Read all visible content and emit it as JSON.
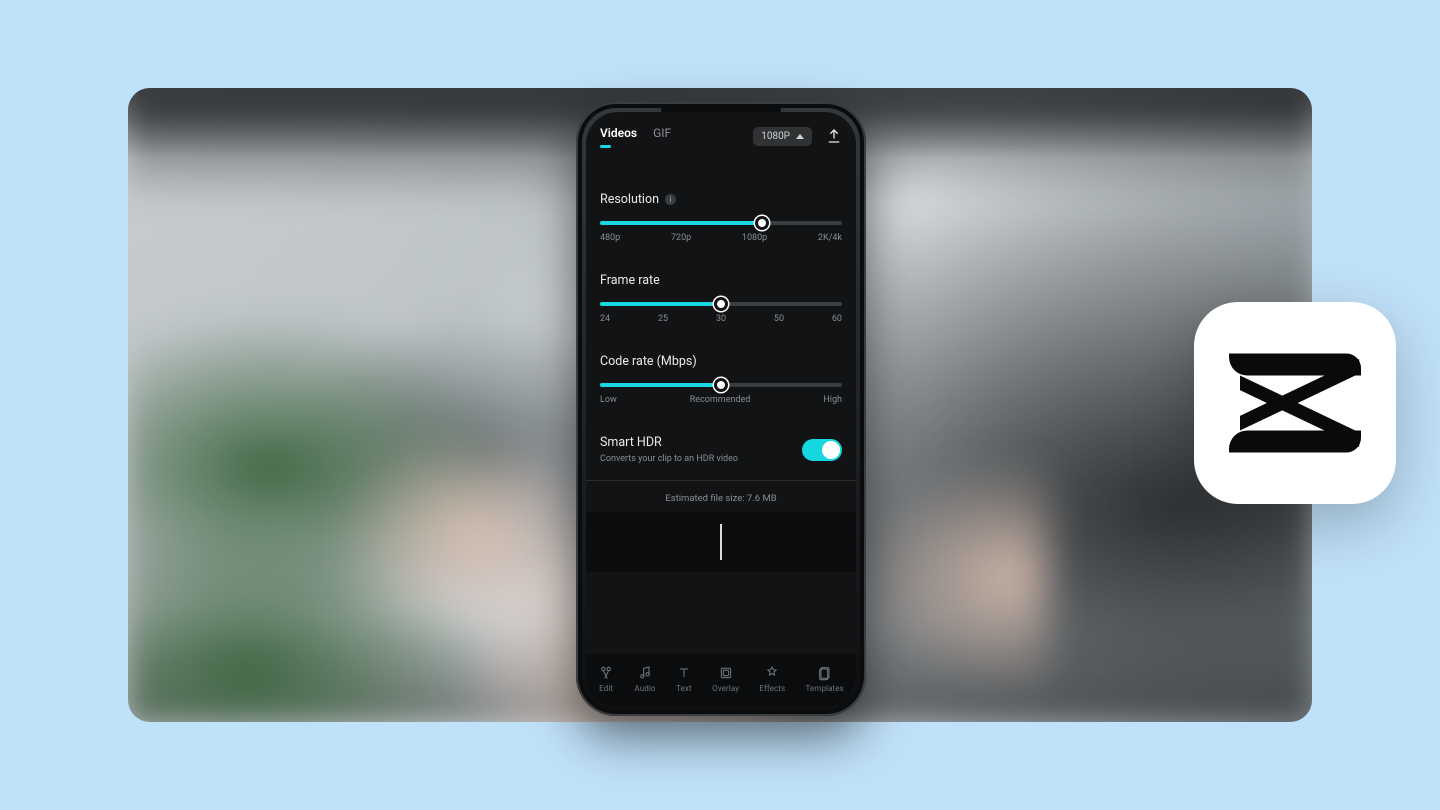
{
  "topbar": {
    "tabs": {
      "videos": "Videos",
      "gif": "GIF"
    },
    "resolution_button": "1080P"
  },
  "resolution": {
    "label": "Resolution",
    "ticks": [
      "480p",
      "720p",
      "1080p",
      "2K/4k"
    ],
    "fill_pct": 67,
    "thumb_pct": 67
  },
  "framerate": {
    "label": "Frame rate",
    "ticks": [
      "24",
      "25",
      "30",
      "50",
      "60"
    ],
    "fill_pct": 50,
    "thumb_pct": 50
  },
  "coderate": {
    "label": "Code rate (Mbps)",
    "ticks": [
      "Low",
      "Recommended",
      "High"
    ],
    "fill_pct": 50,
    "thumb_pct": 50
  },
  "smarthdr": {
    "label": "Smart HDR",
    "sub": "Converts your clip to an HDR video",
    "on": true
  },
  "estimate": "Estimated file size: 7.6 MB",
  "toolbar": {
    "items": [
      {
        "id": "edit",
        "label": "Edit"
      },
      {
        "id": "audio",
        "label": "Audio"
      },
      {
        "id": "text",
        "label": "Text"
      },
      {
        "id": "overlay",
        "label": "Overlay"
      },
      {
        "id": "effects",
        "label": "Effects"
      },
      {
        "id": "templates",
        "label": "Templates"
      }
    ]
  },
  "badge": {
    "name": "CapCut"
  }
}
